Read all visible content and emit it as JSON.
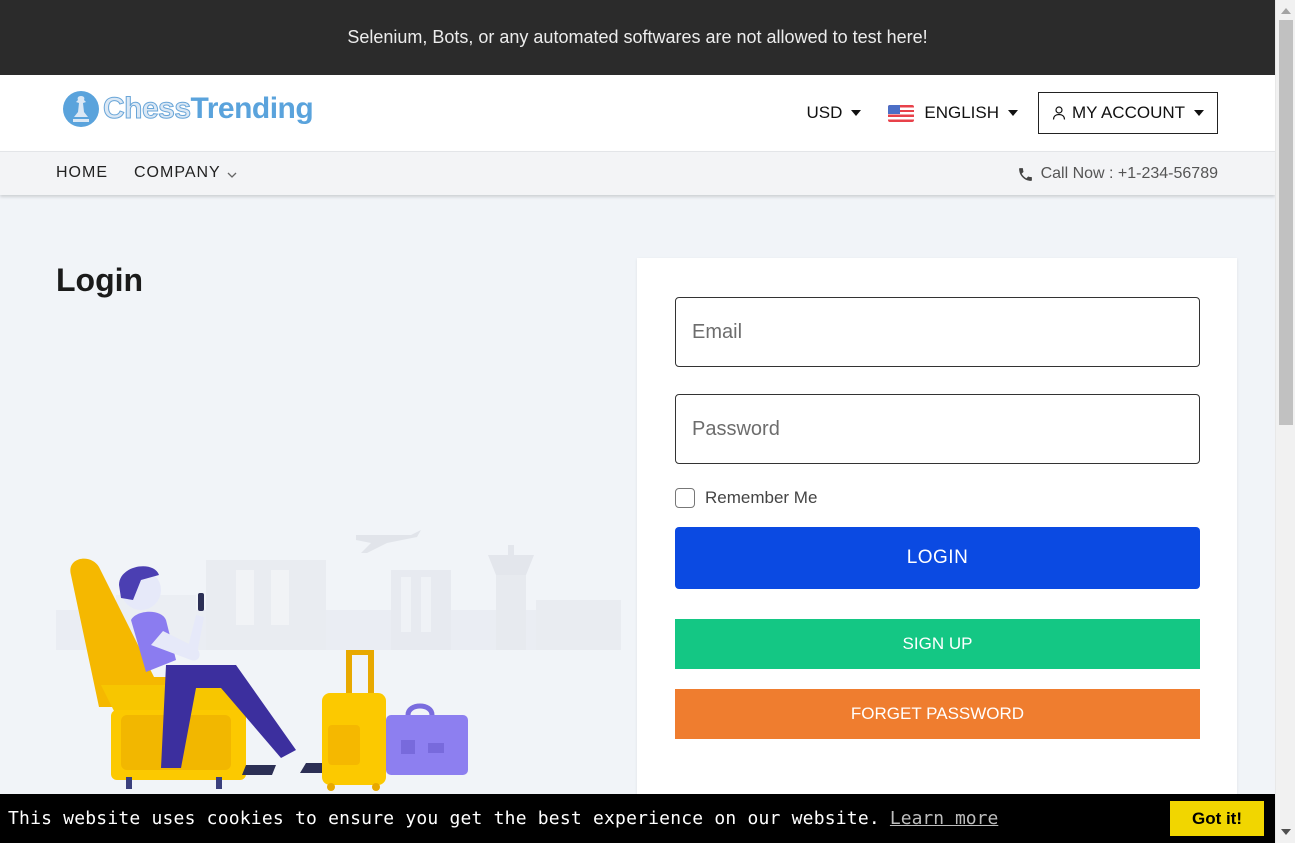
{
  "notice": {
    "text": "Selenium, Bots, or any automated softwares are not allowed to test here!"
  },
  "header": {
    "logo": {
      "part1": "Chess",
      "part2": "Trending",
      "icon": "chess-piece-icon"
    },
    "currency": {
      "label": "USD"
    },
    "language": {
      "label": "ENGLISH",
      "flag": "us-flag-icon"
    },
    "account": {
      "label": "MY ACCOUNT",
      "icon": "user-icon"
    }
  },
  "nav": {
    "items": [
      {
        "label": "HOME"
      },
      {
        "label": "COMPANY"
      }
    ],
    "call": {
      "label": "Call Now : +1-234-56789",
      "icon": "phone-icon"
    }
  },
  "main": {
    "title": "Login"
  },
  "form": {
    "email": {
      "placeholder": "Email",
      "value": ""
    },
    "password": {
      "placeholder": "Password",
      "value": ""
    },
    "remember": {
      "label": "Remember Me",
      "checked": false
    },
    "login_label": "LOGIN",
    "signup_label": "SIGN UP",
    "forget_label": "FORGET PASSWORD"
  },
  "cookie": {
    "message": "This website uses cookies to ensure you get the best experience on our website.",
    "link_label": "Learn more",
    "button_label": "Got it!"
  },
  "colors": {
    "notice_bg": "#2b2b2b",
    "login": "#0b4ae2",
    "signup": "#14c784",
    "forget": "#ef7d2f",
    "cookie_button": "#f1d600"
  }
}
